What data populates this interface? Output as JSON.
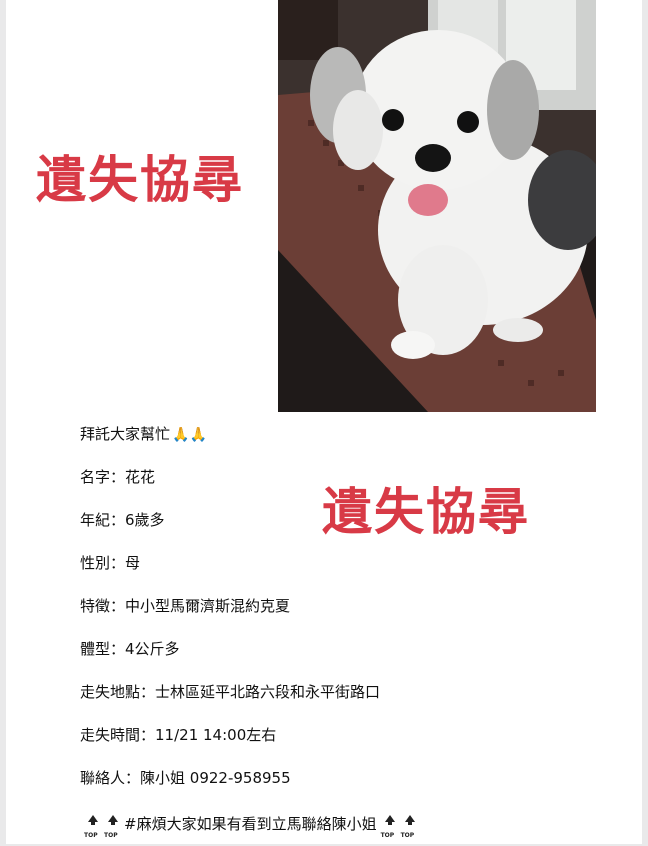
{
  "banner": {
    "left_text": "遺失協尋",
    "right_text": "遺失協尋",
    "color": "#d83a46"
  },
  "photo": {
    "subject": "white-and-grey-small-dog-photo"
  },
  "intro": {
    "text": "拜託大家幫忙",
    "emoji": "🙏🙏"
  },
  "fields": [
    {
      "label": "名字：",
      "value": "花花"
    },
    {
      "label": "年紀：",
      "value": "6歲多"
    },
    {
      "label": "性別：",
      "value": "母"
    },
    {
      "label": "特徵：",
      "value": "中小型馬爾濟斯混約克夏"
    },
    {
      "label": "體型：",
      "value": "4公斤多"
    },
    {
      "label": "走失地點：",
      "value": "士林區延平北路六段和永平街路口"
    },
    {
      "label": "走失時間：",
      "value": "11/21 14:00左右"
    },
    {
      "label": "聯絡人：",
      "value": "陳小姐 0922-958955"
    }
  ],
  "footer": {
    "text": "#麻煩大家如果有看到立馬聯絡陳小姐",
    "icon_label": "TOP"
  }
}
